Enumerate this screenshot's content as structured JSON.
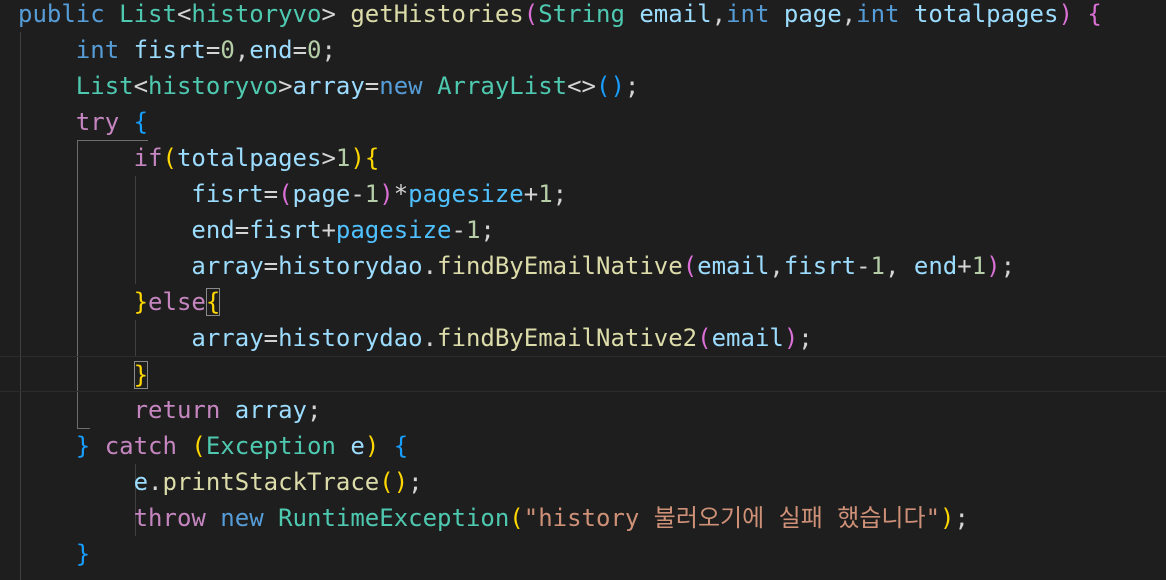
{
  "code_lines": [
    {
      "tokens": [
        {
          "t": "public",
          "c": "kw"
        },
        {
          "t": " ",
          "c": "op"
        },
        {
          "t": "List",
          "c": "type"
        },
        {
          "t": "<",
          "c": "op"
        },
        {
          "t": "historyvo",
          "c": "type"
        },
        {
          "t": ">",
          "c": "op"
        },
        {
          "t": " ",
          "c": "op"
        },
        {
          "t": "getHistories",
          "c": "fn"
        },
        {
          "t": "(",
          "c": "p2"
        },
        {
          "t": "String",
          "c": "type"
        },
        {
          "t": " ",
          "c": "op"
        },
        {
          "t": "email",
          "c": "var"
        },
        {
          "t": ",",
          "c": "op"
        },
        {
          "t": "int",
          "c": "kw"
        },
        {
          "t": " ",
          "c": "op"
        },
        {
          "t": "page",
          "c": "var"
        },
        {
          "t": ",",
          "c": "op"
        },
        {
          "t": "int",
          "c": "kw"
        },
        {
          "t": " ",
          "c": "op"
        },
        {
          "t": "totalpages",
          "c": "var"
        },
        {
          "t": ")",
          "c": "p2"
        },
        {
          "t": " ",
          "c": "op"
        },
        {
          "t": "{",
          "c": "p2"
        }
      ]
    },
    {
      "tokens": [
        {
          "t": "    ",
          "c": "op"
        },
        {
          "t": "int",
          "c": "kw"
        },
        {
          "t": " ",
          "c": "op"
        },
        {
          "t": "fisrt",
          "c": "var"
        },
        {
          "t": "=",
          "c": "op"
        },
        {
          "t": "0",
          "c": "num"
        },
        {
          "t": ",",
          "c": "op"
        },
        {
          "t": "end",
          "c": "var"
        },
        {
          "t": "=",
          "c": "op"
        },
        {
          "t": "0",
          "c": "num"
        },
        {
          "t": ";",
          "c": "op"
        }
      ]
    },
    {
      "tokens": [
        {
          "t": "    ",
          "c": "op"
        },
        {
          "t": "List",
          "c": "type"
        },
        {
          "t": "<",
          "c": "op"
        },
        {
          "t": "historyvo",
          "c": "type"
        },
        {
          "t": ">",
          "c": "op"
        },
        {
          "t": "array",
          "c": "var"
        },
        {
          "t": "=",
          "c": "op"
        },
        {
          "t": "new",
          "c": "kw"
        },
        {
          "t": " ",
          "c": "op"
        },
        {
          "t": "ArrayList",
          "c": "type"
        },
        {
          "t": "<>",
          "c": "op"
        },
        {
          "t": "()",
          "c": "p3"
        },
        {
          "t": ";",
          "c": "op"
        }
      ]
    },
    {
      "tokens": [
        {
          "t": "    ",
          "c": "op"
        },
        {
          "t": "try",
          "c": "kwc"
        },
        {
          "t": " ",
          "c": "op"
        },
        {
          "t": "{",
          "c": "p3"
        }
      ]
    },
    {
      "tokens": [
        {
          "t": "        ",
          "c": "op"
        },
        {
          "t": "if",
          "c": "kwc"
        },
        {
          "t": "(",
          "c": "p1"
        },
        {
          "t": "totalpages",
          "c": "var"
        },
        {
          "t": ">",
          "c": "op"
        },
        {
          "t": "1",
          "c": "num"
        },
        {
          "t": ")",
          "c": "p1"
        },
        {
          "t": "{",
          "c": "p1"
        }
      ]
    },
    {
      "tokens": [
        {
          "t": "            ",
          "c": "op"
        },
        {
          "t": "fisrt",
          "c": "var"
        },
        {
          "t": "=",
          "c": "op"
        },
        {
          "t": "(",
          "c": "p2"
        },
        {
          "t": "page",
          "c": "var"
        },
        {
          "t": "-",
          "c": "op"
        },
        {
          "t": "1",
          "c": "num"
        },
        {
          "t": ")",
          "c": "p2"
        },
        {
          "t": "*",
          "c": "op"
        },
        {
          "t": "pagesize",
          "c": "const"
        },
        {
          "t": "+",
          "c": "op"
        },
        {
          "t": "1",
          "c": "num"
        },
        {
          "t": ";",
          "c": "op"
        }
      ]
    },
    {
      "tokens": [
        {
          "t": "            ",
          "c": "op"
        },
        {
          "t": "end",
          "c": "var"
        },
        {
          "t": "=",
          "c": "op"
        },
        {
          "t": "fisrt",
          "c": "var"
        },
        {
          "t": "+",
          "c": "op"
        },
        {
          "t": "pagesize",
          "c": "const"
        },
        {
          "t": "-",
          "c": "op"
        },
        {
          "t": "1",
          "c": "num"
        },
        {
          "t": ";",
          "c": "op"
        }
      ]
    },
    {
      "tokens": [
        {
          "t": "            ",
          "c": "op"
        },
        {
          "t": "array",
          "c": "var"
        },
        {
          "t": "=",
          "c": "op"
        },
        {
          "t": "historydao",
          "c": "var"
        },
        {
          "t": ".",
          "c": "op"
        },
        {
          "t": "findByEmailNative",
          "c": "fn"
        },
        {
          "t": "(",
          "c": "p2"
        },
        {
          "t": "email",
          "c": "var"
        },
        {
          "t": ",",
          "c": "op"
        },
        {
          "t": "fisrt",
          "c": "var"
        },
        {
          "t": "-",
          "c": "op"
        },
        {
          "t": "1",
          "c": "num"
        },
        {
          "t": ", ",
          "c": "op"
        },
        {
          "t": "end",
          "c": "var"
        },
        {
          "t": "+",
          "c": "op"
        },
        {
          "t": "1",
          "c": "num"
        },
        {
          "t": ")",
          "c": "p2"
        },
        {
          "t": ";",
          "c": "op"
        }
      ]
    },
    {
      "tokens": [
        {
          "t": "        ",
          "c": "op"
        },
        {
          "t": "}",
          "c": "p1"
        },
        {
          "t": "else",
          "c": "kwc"
        },
        {
          "t": "{",
          "c": "p1",
          "box": true
        }
      ]
    },
    {
      "tokens": [
        {
          "t": "            ",
          "c": "op"
        },
        {
          "t": "array",
          "c": "var"
        },
        {
          "t": "=",
          "c": "op"
        },
        {
          "t": "historydao",
          "c": "var"
        },
        {
          "t": ".",
          "c": "op"
        },
        {
          "t": "findByEmailNative2",
          "c": "fn"
        },
        {
          "t": "(",
          "c": "p2"
        },
        {
          "t": "email",
          "c": "var"
        },
        {
          "t": ")",
          "c": "p2"
        },
        {
          "t": ";",
          "c": "op"
        }
      ]
    },
    {
      "tokens": [
        {
          "t": "        ",
          "c": "op"
        },
        {
          "t": "}",
          "c": "p1",
          "box": true
        }
      ]
    },
    {
      "tokens": [
        {
          "t": "        ",
          "c": "op"
        },
        {
          "t": "return",
          "c": "kwc"
        },
        {
          "t": " ",
          "c": "op"
        },
        {
          "t": "array",
          "c": "var"
        },
        {
          "t": ";",
          "c": "op"
        }
      ]
    },
    {
      "tokens": [
        {
          "t": "    ",
          "c": "op"
        },
        {
          "t": "}",
          "c": "p3"
        },
        {
          "t": " ",
          "c": "op"
        },
        {
          "t": "catch",
          "c": "kwc"
        },
        {
          "t": " ",
          "c": "op"
        },
        {
          "t": "(",
          "c": "p1"
        },
        {
          "t": "Exception",
          "c": "type"
        },
        {
          "t": " ",
          "c": "op"
        },
        {
          "t": "e",
          "c": "var"
        },
        {
          "t": ")",
          "c": "p1"
        },
        {
          "t": " ",
          "c": "op"
        },
        {
          "t": "{",
          "c": "p3"
        }
      ]
    },
    {
      "tokens": [
        {
          "t": "        ",
          "c": "op"
        },
        {
          "t": "e",
          "c": "var"
        },
        {
          "t": ".",
          "c": "op"
        },
        {
          "t": "printStackTrace",
          "c": "fn"
        },
        {
          "t": "()",
          "c": "p1"
        },
        {
          "t": ";",
          "c": "op"
        }
      ]
    },
    {
      "tokens": [
        {
          "t": "        ",
          "c": "op"
        },
        {
          "t": "throw",
          "c": "kwc"
        },
        {
          "t": " ",
          "c": "op"
        },
        {
          "t": "new",
          "c": "kw"
        },
        {
          "t": " ",
          "c": "op"
        },
        {
          "t": "RuntimeException",
          "c": "type"
        },
        {
          "t": "(",
          "c": "p1"
        },
        {
          "t": "\"history 불러오기에 실패 했습니다\"",
          "c": "str"
        },
        {
          "t": ")",
          "c": "p1"
        },
        {
          "t": ";",
          "c": "op"
        }
      ]
    },
    {
      "tokens": [
        {
          "t": "    ",
          "c": "op"
        },
        {
          "t": "}",
          "c": "p3"
        }
      ]
    }
  ],
  "current_line_index": 10,
  "colors": {
    "background": "#1e1e1e",
    "keyword": "#569cd6",
    "control_keyword": "#c586c0",
    "type": "#4ec9b0",
    "function": "#dcdcaa",
    "variable": "#9cdcfe",
    "constant": "#4fc1ff",
    "number": "#b5cea8",
    "string": "#ce9178",
    "bracket_1": "#ffd700",
    "bracket_2": "#da70d6",
    "bracket_3": "#179fff"
  }
}
